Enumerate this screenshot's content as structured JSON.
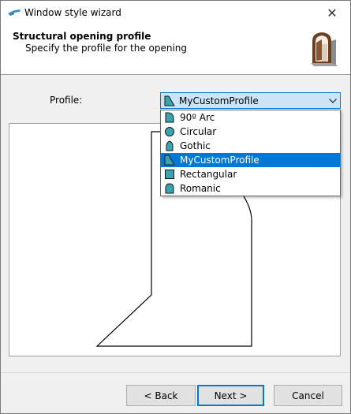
{
  "window": {
    "title": "Window style wizard"
  },
  "header": {
    "title": "Structural opening profile",
    "subtitle": "Specify the profile for the opening"
  },
  "form": {
    "profile_label": "Profile:",
    "selected_profile": "MyCustomProfile"
  },
  "dropdown": {
    "items": [
      {
        "label": "90º Arc",
        "icon": "arc-profile-icon"
      },
      {
        "label": "Circular",
        "icon": "circular-profile-icon"
      },
      {
        "label": "Gothic",
        "icon": "gothic-profile-icon"
      },
      {
        "label": "MyCustomProfile",
        "icon": "custom-profile-icon",
        "selected": true
      },
      {
        "label": "Rectangular",
        "icon": "rectangular-profile-icon"
      },
      {
        "label": "Romanic",
        "icon": "romanic-profile-icon"
      }
    ]
  },
  "buttons": {
    "back": "< Back",
    "next": "Next >",
    "cancel": "Cancel"
  },
  "colors": {
    "icon_fill": "#3aa3b0",
    "selection": "#0078d7",
    "combo_bg": "#cce4f7"
  }
}
